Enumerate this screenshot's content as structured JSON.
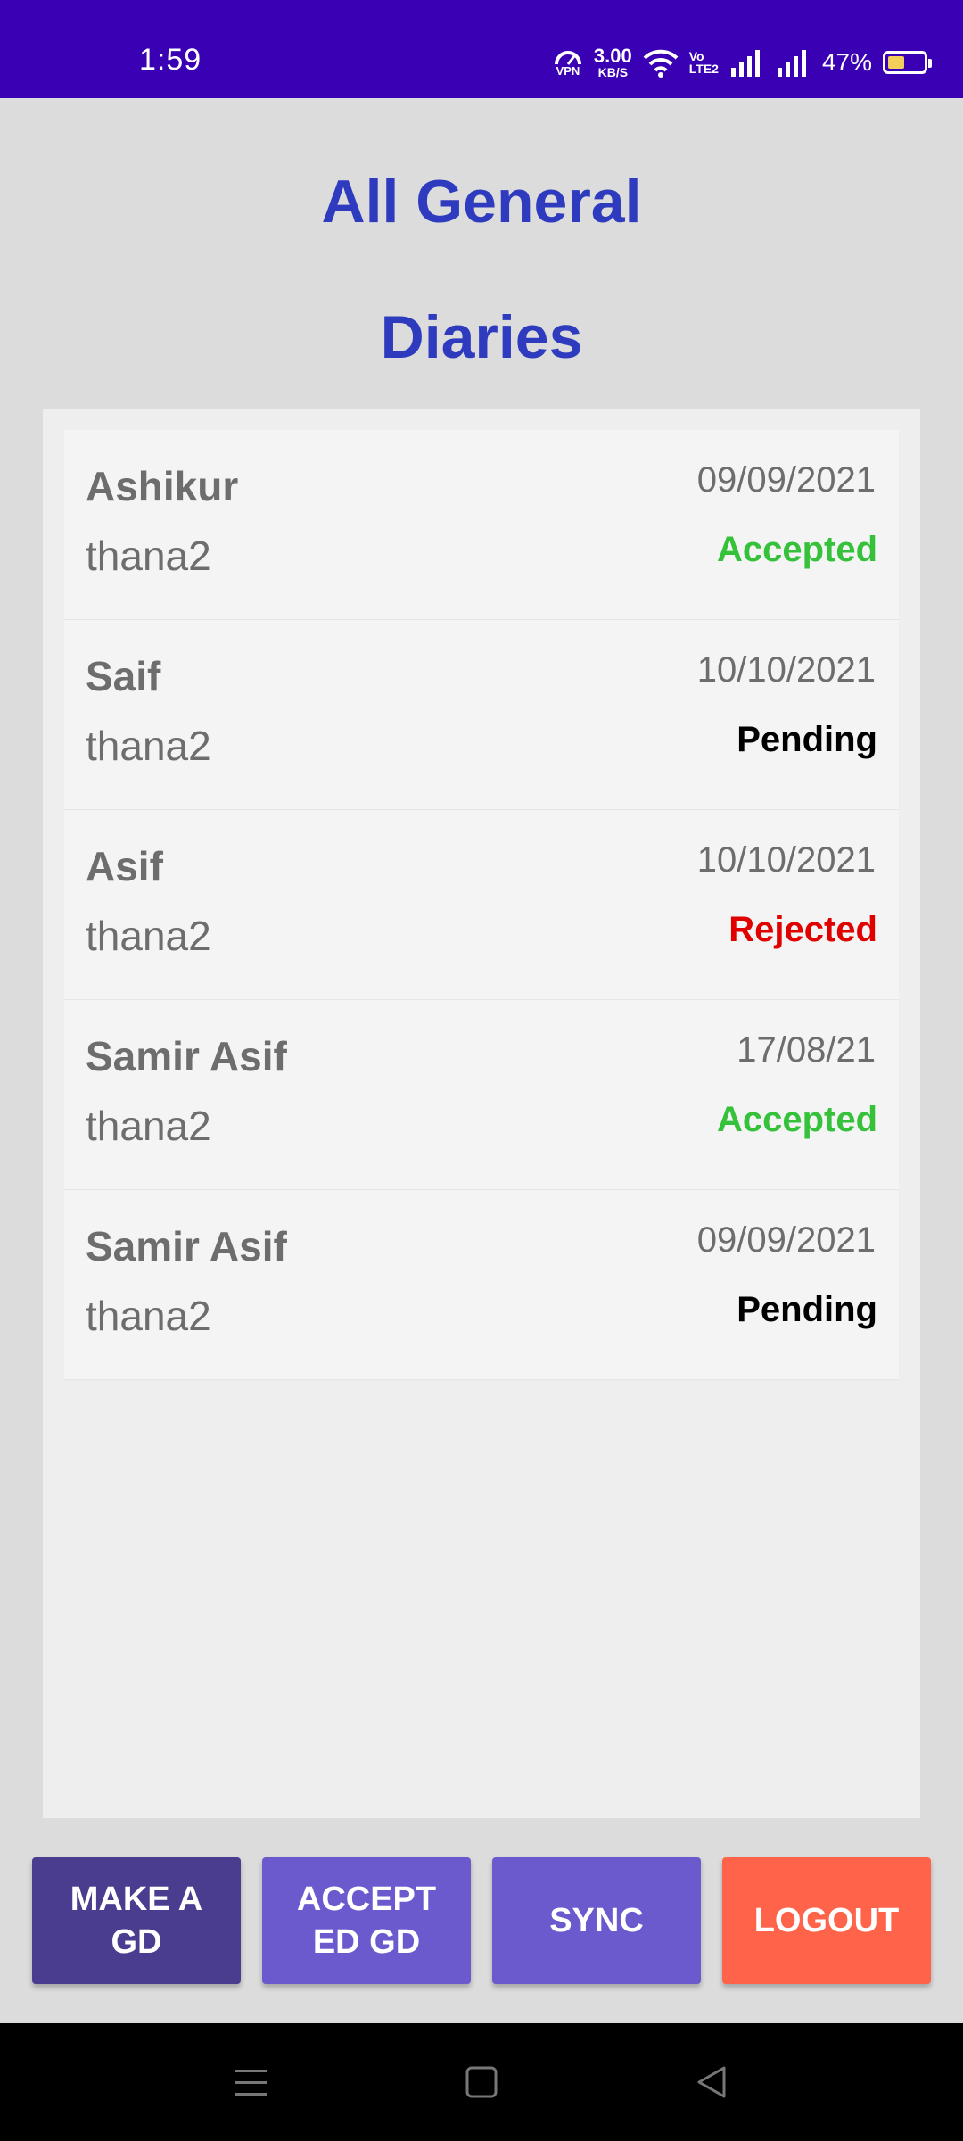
{
  "status_bar": {
    "time": "1:59",
    "vpn_label": "VPN",
    "net_speed_value": "3.00",
    "net_speed_unit": "KB/S",
    "volte_top": "Vo",
    "volte_bottom": "LTE2",
    "battery_percent": "47%",
    "icons": [
      "vpn-icon",
      "wifi-icon",
      "volte-icon",
      "signal-icon",
      "signal-icon",
      "battery-icon"
    ]
  },
  "page": {
    "title_line1": "All General",
    "title_line2": "Diaries"
  },
  "diaries": [
    {
      "name": "Ashikur",
      "thana": "thana2",
      "date": "09/09/2021",
      "status": "Accepted"
    },
    {
      "name": "Saif",
      "thana": "thana2",
      "date": "10/10/2021",
      "status": "Pending"
    },
    {
      "name": "Asif",
      "thana": "thana2",
      "date": "10/10/2021",
      "status": "Rejected"
    },
    {
      "name": "Samir Asif",
      "thana": "thana2",
      "date": "17/08/21",
      "status": "Accepted"
    },
    {
      "name": "Samir Asif",
      "thana": "thana2",
      "date": "09/09/2021",
      "status": "Pending"
    }
  ],
  "status_colors": {
    "Accepted": "#35c23a",
    "Pending": "#000000",
    "Rejected": "#e00000"
  },
  "buttons": {
    "make_gd": "MAKE A\nGD",
    "accepted_gd": "ACCEPT\nED GD",
    "sync": "SYNC",
    "logout": "LOGOUT"
  },
  "colors": {
    "status_bar": "#3a00b4",
    "title": "#2f3bbe",
    "make_gd": "#4a3d8f",
    "accepted_gd": "#6a5acd",
    "sync": "#6a5acd",
    "logout": "#ff634a"
  },
  "nav_bar": {
    "icons": [
      "menu-icon",
      "home-icon",
      "back-icon"
    ]
  }
}
